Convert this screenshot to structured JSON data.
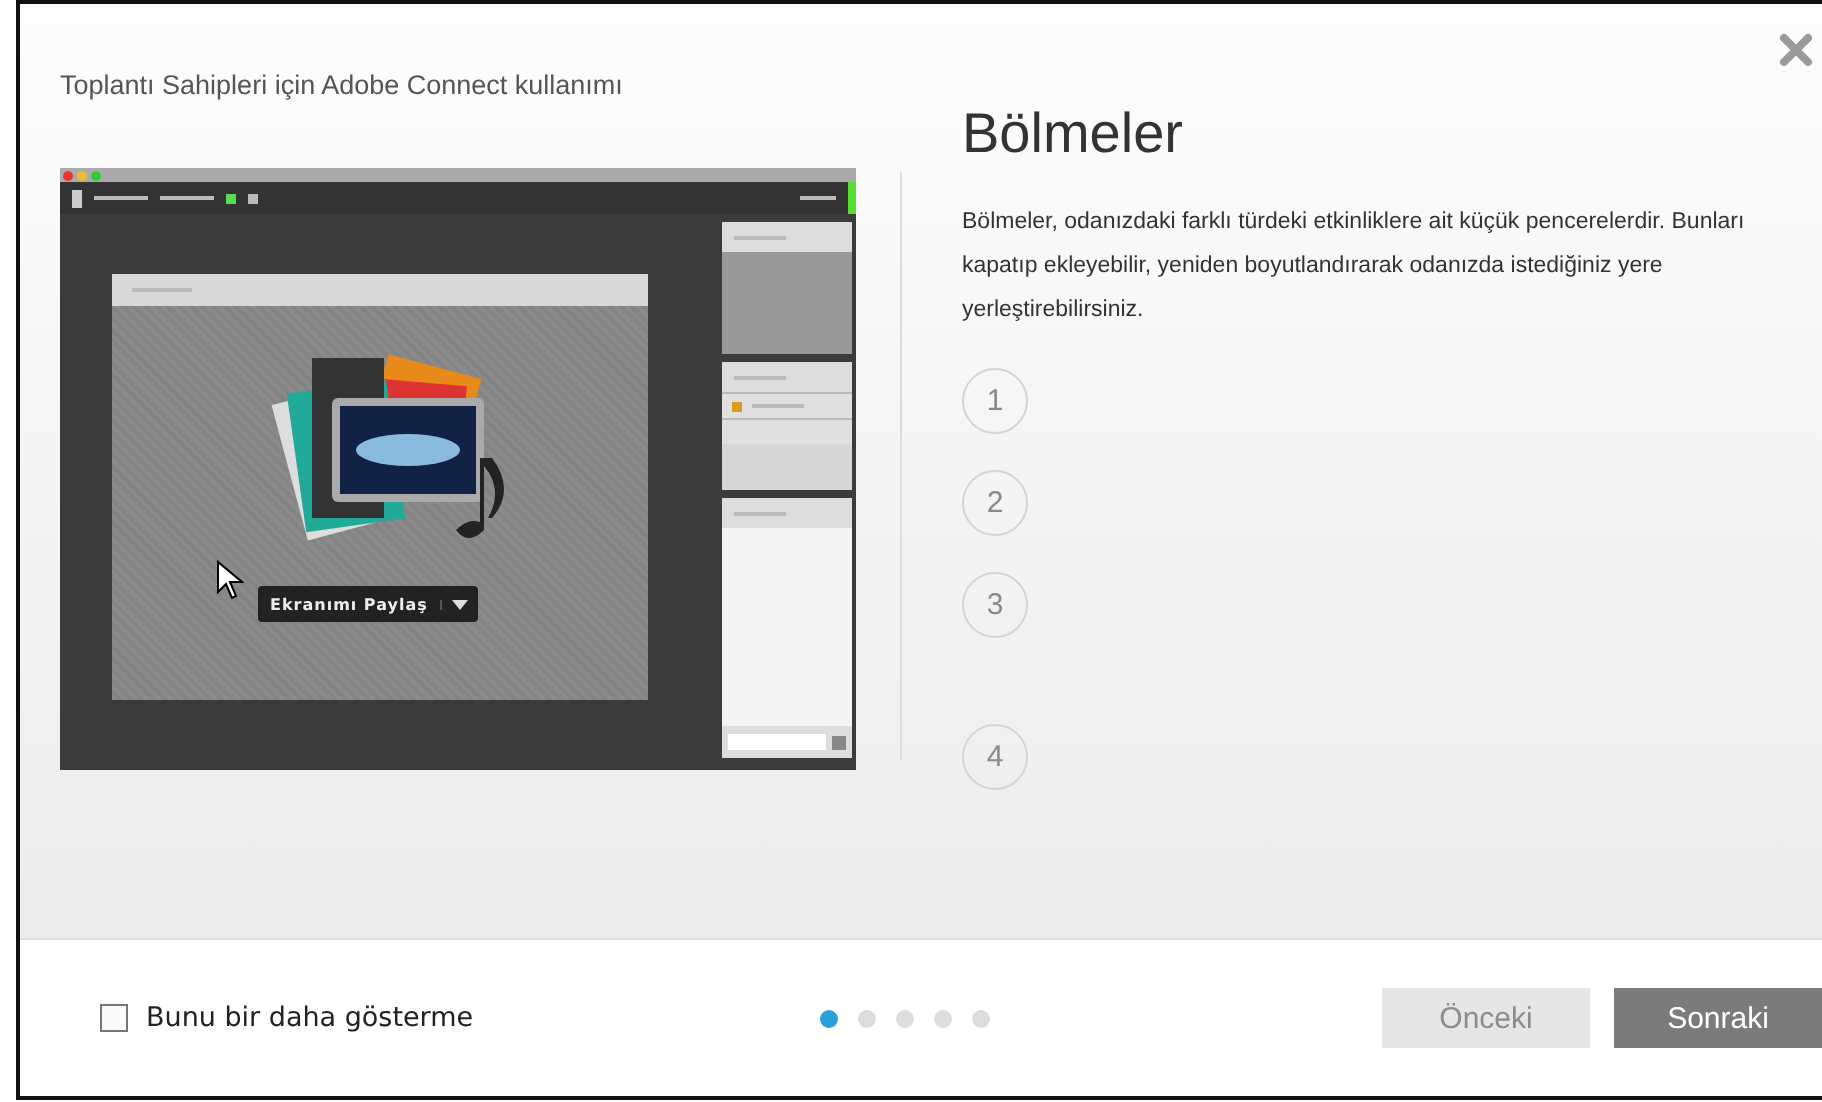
{
  "window": {
    "title": "Toplantı Sahipleri için Adobe Connect kullanımı"
  },
  "heading": "Bölmeler",
  "description": "Bölmeler, odanızdaki farklı türdeki etkinliklere ait küçük pencerelerdir. Bunları kapatıp ekleyebilir, yeniden boyutlandırarak odanızda istediğiniz yere yerleştirebilirsiniz.",
  "illustration": {
    "share_button": "Ekranımı Paylaş"
  },
  "steps": [
    {
      "label": "1"
    },
    {
      "label": "2"
    },
    {
      "label": "3"
    },
    {
      "label": "4"
    }
  ],
  "footer": {
    "checkbox": {
      "label": "Bunu bir daha gösterme",
      "checked": false
    },
    "pager": [
      {
        "selected": true
      },
      {
        "selected": false
      },
      {
        "selected": false
      },
      {
        "selected": false
      },
      {
        "selected": false
      }
    ],
    "buttons": [
      {
        "label": "Önceki",
        "disabled": true
      },
      {
        "label": "Sonraki",
        "disabled": false
      }
    ]
  }
}
